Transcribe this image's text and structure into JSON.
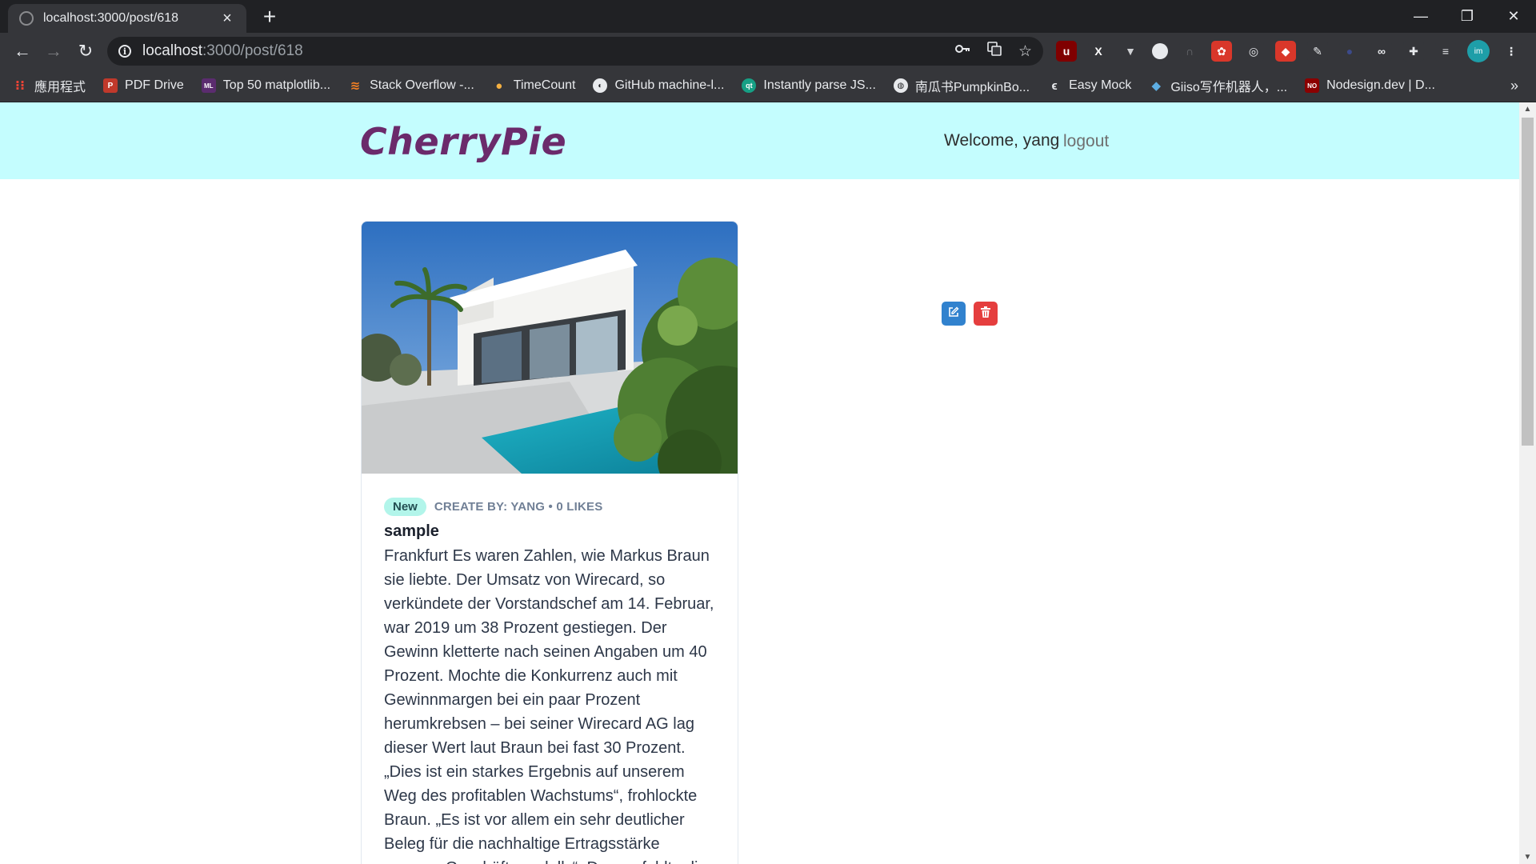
{
  "browser": {
    "tab_title": "localhost:3000/post/618",
    "url_host": "localhost",
    "url_path": ":3000/post/618",
    "bookmarks": [
      {
        "label": "應用程式",
        "icon": "apps-grid-icon",
        "color": "#ea4335"
      },
      {
        "label": "PDF Drive",
        "icon": "pdf-drive-icon",
        "color": "#c0392b"
      },
      {
        "label": "Top 50 matplotlib...",
        "icon": "ml-icon",
        "color": "#5b2c6f"
      },
      {
        "label": "Stack Overflow -...",
        "icon": "stackoverflow-icon",
        "color": "#f48024"
      },
      {
        "label": "TimeCount",
        "icon": "timecount-icon",
        "color": "#f5b041"
      },
      {
        "label": "GitHub machine-l...",
        "icon": "github-icon",
        "color": "#ffffff"
      },
      {
        "label": "Instantly parse JS...",
        "icon": "quicktype-icon",
        "color": "#16a085"
      },
      {
        "label": "南瓜书PumpkinBo...",
        "icon": "globe-icon",
        "color": "#e8eaed"
      },
      {
        "label": "Easy Mock",
        "icon": "easymock-icon",
        "color": "#e8eaed"
      },
      {
        "label": "Giiso写作机器人，...",
        "icon": "giiso-icon",
        "color": "#2e86c1"
      },
      {
        "label": "Nodesign.dev | D...",
        "icon": "nodesign-icon",
        "color": "#c0392b"
      }
    ],
    "bookmarks_more": "»"
  },
  "app": {
    "brand": "CherryPie",
    "welcome": "Welcome, yang",
    "logout": "logout",
    "accent_color": "#c4fdfe",
    "brand_color": "#6b2a6b"
  },
  "post": {
    "badge": "New",
    "meta": "Create by: yang • 0 likes",
    "title": "sample",
    "body": "Frankfurt Es waren Zahlen, wie Markus Braun sie liebte. Der Umsatz von Wirecard, so verkündete der Vorstandschef am 14. Februar, war 2019 um 38 Prozent gestiegen. Der Gewinn kletterte nach seinen Angaben um 40 Prozent. Mochte die Konkurrenz auch mit Gewinnmargen bei ein paar Prozent herumkrebsen – bei seiner Wirecard AG lag dieser Wert laut Braun bei fast 30 Prozent. „Dies ist ein starkes Ergebnis auf unserem Weg des profitablen Wachstums“, frohlockte Braun. „Es ist vor allem ein sehr deutlicher Beleg für die nachhaltige Ertragsstärke unseres Geschäftsmodells“. Das verfehlte die Wirkung nicht.",
    "actions": {
      "edit_icon": "edit-icon",
      "delete_icon": "trash-icon",
      "edit_color": "#3182ce",
      "delete_color": "#e53e3e"
    }
  }
}
